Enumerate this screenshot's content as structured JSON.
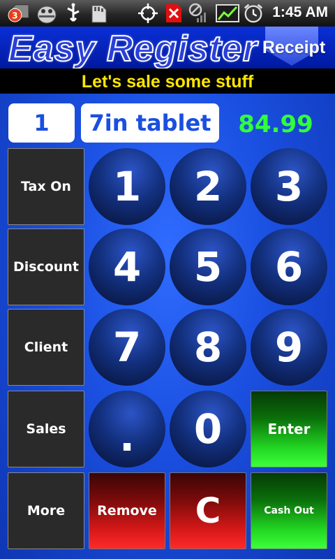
{
  "status_bar": {
    "notification_count": "3",
    "time": "1:45 AM",
    "icons": [
      "notification-badge-icon",
      "android-bug-icon",
      "usb-icon",
      "sd-card-icon",
      "gps-crosshair-icon",
      "no-signal-icon",
      "no-sim-icon",
      "sync-chart-icon",
      "alarm-clock-icon"
    ]
  },
  "header": {
    "app_title": "Easy Register",
    "receipt_label": "Receipt"
  },
  "slogan": "Let's sale some stuff",
  "entry": {
    "quantity": "1",
    "item_name": "7in tablet",
    "price": "84.99"
  },
  "side_buttons": {
    "tax": "Tax On",
    "discount": "Discount",
    "client": "Client",
    "sales": "Sales",
    "more": "More"
  },
  "keypad": {
    "k1": "1",
    "k2": "2",
    "k3": "3",
    "k4": "4",
    "k5": "5",
    "k6": "6",
    "k7": "7",
    "k8": "8",
    "k9": "9",
    "dot": ".",
    "k0": "0"
  },
  "actions": {
    "enter": "Enter",
    "remove": "Remove",
    "clear": "C",
    "cash_out": "Cash Out"
  },
  "colors": {
    "background": "#1a4fe0",
    "price": "#32ff3a",
    "slogan_text": "#ffe600",
    "enter": "#22d622",
    "danger": "#d61818"
  }
}
